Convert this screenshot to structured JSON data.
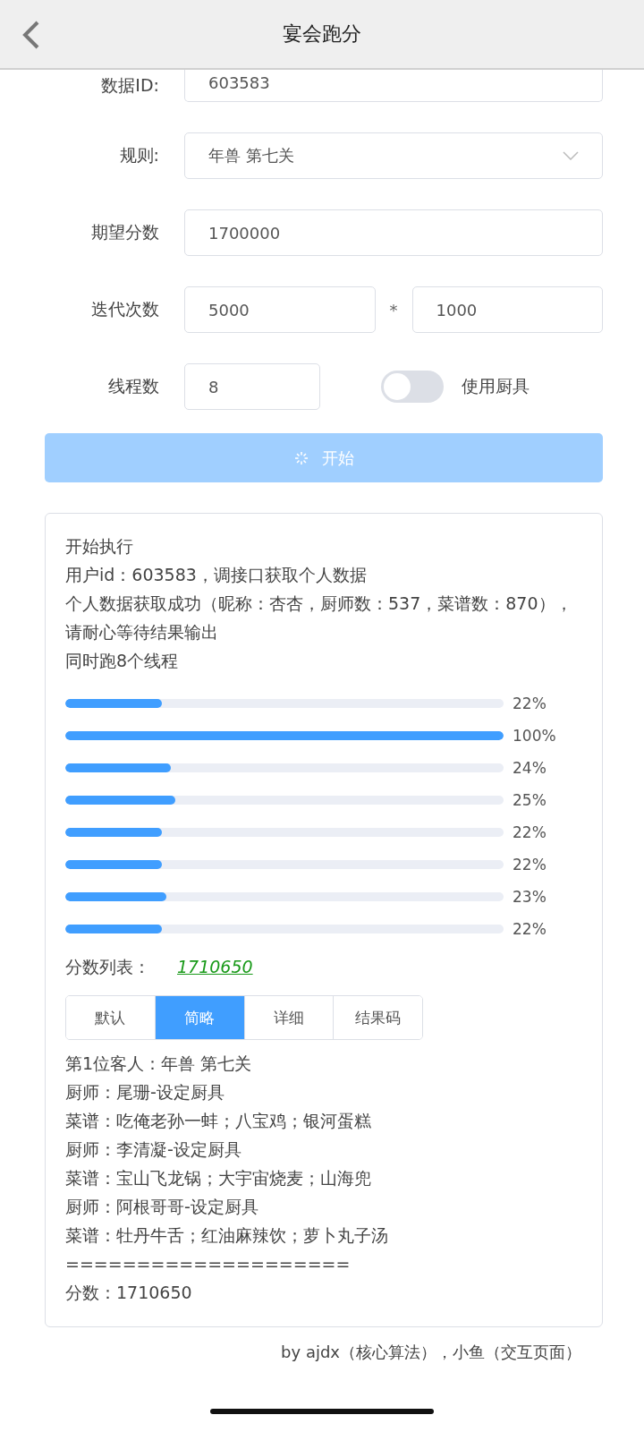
{
  "header": {
    "title": "宴会跑分"
  },
  "form": {
    "data_id": {
      "label": "数据ID:",
      "value": "603583"
    },
    "rule": {
      "label": "规则:",
      "value": "年兽 第七关"
    },
    "expected_score": {
      "label": "期望分数",
      "value": "1700000"
    },
    "iterations": {
      "label": "迭代次数",
      "value_1": "5000",
      "separator": "*",
      "value_2": "1000"
    },
    "threads": {
      "label": "线程数",
      "value": "8"
    },
    "use_tools": {
      "label": "使用厨具",
      "on": false
    },
    "start_button": {
      "label": "开始",
      "disabled": true
    }
  },
  "log": {
    "lines": [
      "开始执行",
      "用户id：603583，调接口获取个人数据",
      "个人数据获取成功（昵称：杏杏，厨师数：537，菜谱数：870），请耐心等待结果输出",
      "同时跑8个线程"
    ],
    "progress": [
      {
        "level": 0.22,
        "reading": "22%"
      },
      {
        "level": 1,
        "reading": "100%"
      },
      {
        "level": 0.24,
        "reading": "24%"
      },
      {
        "level": 0.25,
        "reading": "25%"
      },
      {
        "level": 0.22,
        "reading": "22%"
      },
      {
        "level": 0.22,
        "reading": "22%"
      },
      {
        "level": 0.23,
        "reading": "23%"
      },
      {
        "level": 0.22,
        "reading": "22%"
      }
    ],
    "score_list": {
      "label": "分数列表：",
      "scores": [
        "1710650"
      ]
    },
    "tabs": [
      {
        "label": "默认",
        "selected": false
      },
      {
        "label": "简略",
        "selected": true
      },
      {
        "label": "详细",
        "selected": false
      },
      {
        "label": "结果码",
        "selected": false
      }
    ],
    "result_lines": [
      "第1位客人：年兽 第七关",
      "厨师：尾珊-设定厨具",
      "菜谱：吃俺老孙一蚌；八宝鸡；银河蛋糕",
      "厨师：李清凝-设定厨具",
      "菜谱：宝山飞龙锅；大宇宙烧麦；山海兜",
      "厨师：阿根哥哥-设定厨具",
      "菜谱：牡丹牛舌；红油麻辣饮；萝卜丸子汤",
      "====================",
      "分数：1710650"
    ]
  },
  "footer": {
    "credit": "by ajdx（核心算法），小鱼（交互页面）"
  }
}
